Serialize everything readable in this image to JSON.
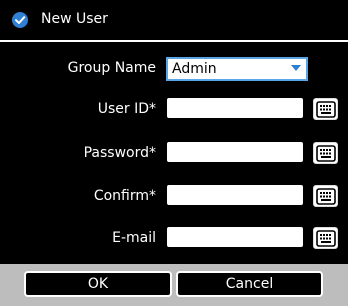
{
  "dialog": {
    "title": "New User",
    "accent_color": "#2f7fd3"
  },
  "form": {
    "group_name": {
      "label": "Group Name",
      "value": "Admin"
    },
    "user_id": {
      "label": "User ID*",
      "value": ""
    },
    "password": {
      "label": "Password*",
      "value": ""
    },
    "confirm": {
      "label": "Confirm*",
      "value": ""
    },
    "email": {
      "label": "E-mail",
      "value": ""
    }
  },
  "icons": {
    "title": "checkmark-circle-icon",
    "keyboard": "keyboard-icon",
    "dropdown": "chevron-down-icon"
  },
  "buttons": {
    "ok": "OK",
    "cancel": "Cancel"
  }
}
